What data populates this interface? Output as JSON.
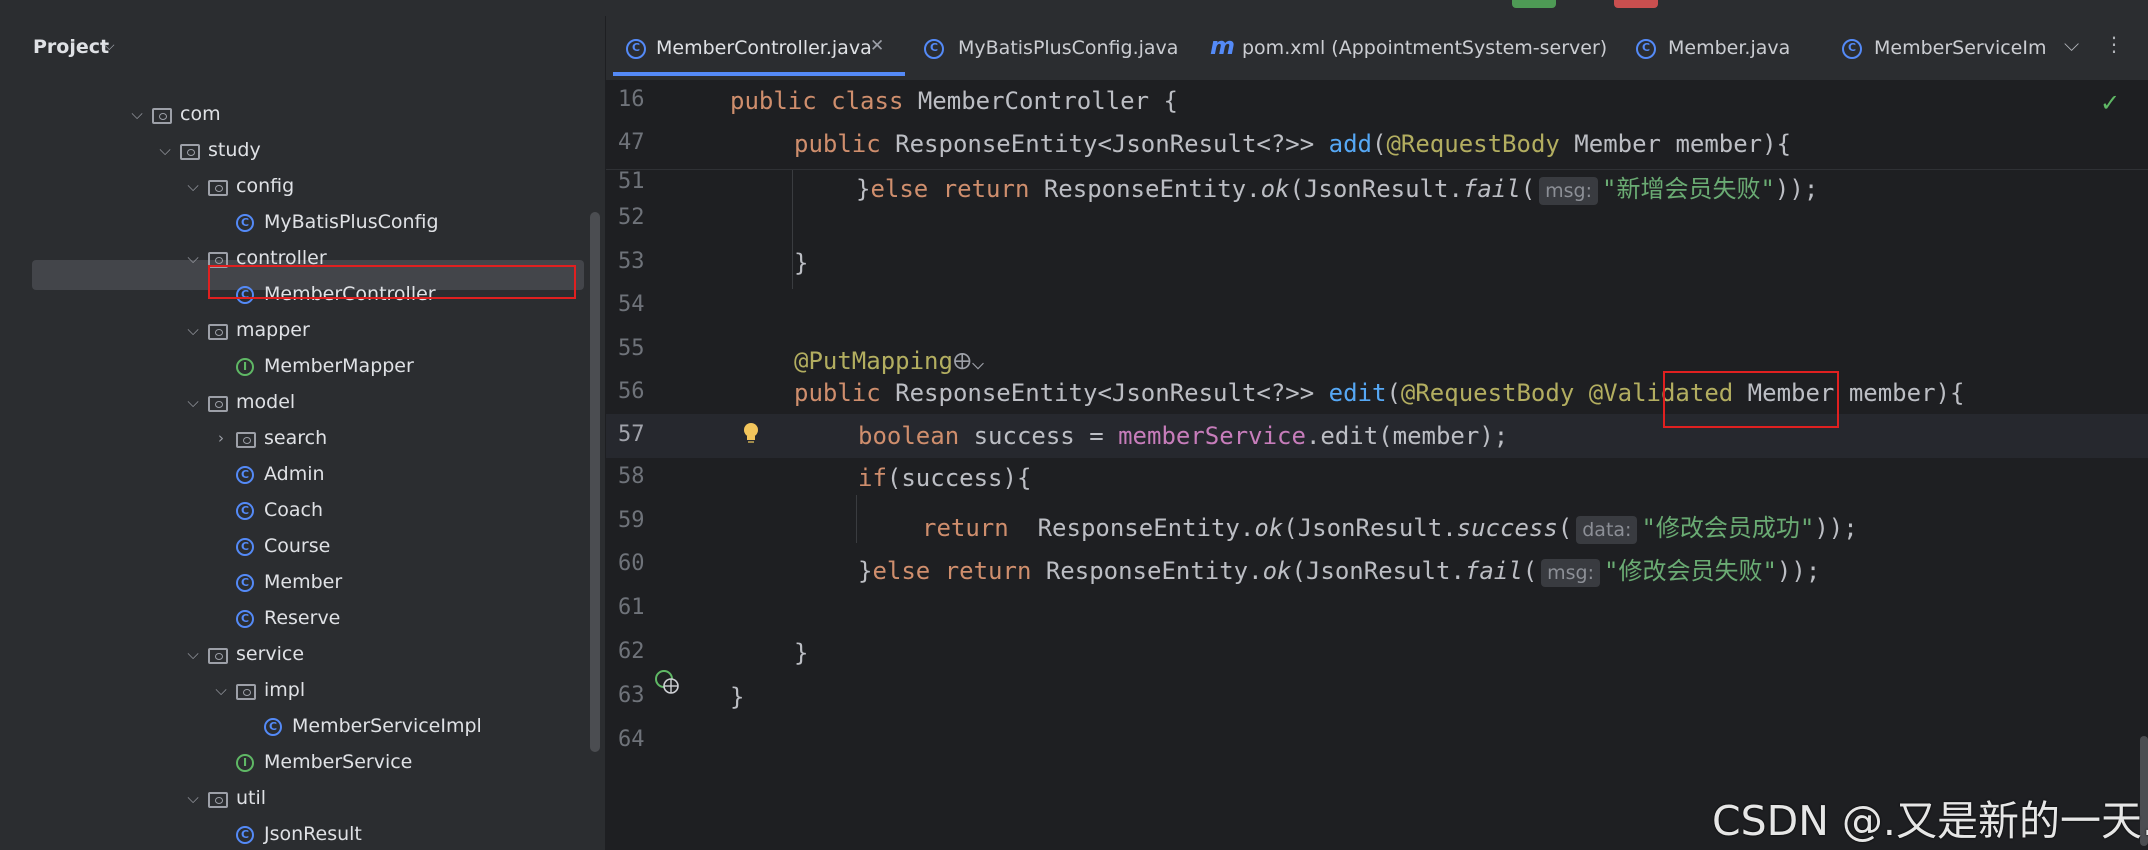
{
  "project_panel": {
    "title": "Project",
    "tree": [
      {
        "label": "com",
        "type": "folder",
        "depth": 0,
        "expanded": true
      },
      {
        "label": "study",
        "type": "folder",
        "depth": 1,
        "expanded": true
      },
      {
        "label": "config",
        "type": "folder",
        "depth": 2,
        "expanded": true
      },
      {
        "label": "MyBatisPlusConfig",
        "type": "class",
        "depth": 3
      },
      {
        "label": "controller",
        "type": "folder",
        "depth": 2,
        "expanded": true
      },
      {
        "label": "MemberController",
        "type": "class",
        "depth": 3,
        "selected": true
      },
      {
        "label": "mapper",
        "type": "folder",
        "depth": 2,
        "expanded": true
      },
      {
        "label": "MemberMapper",
        "type": "interface",
        "depth": 3
      },
      {
        "label": "model",
        "type": "folder",
        "depth": 2,
        "expanded": true
      },
      {
        "label": "search",
        "type": "folder",
        "depth": 3,
        "expanded": false
      },
      {
        "label": "Admin",
        "type": "class",
        "depth": 3
      },
      {
        "label": "Coach",
        "type": "class",
        "depth": 3
      },
      {
        "label": "Course",
        "type": "class",
        "depth": 3
      },
      {
        "label": "Member",
        "type": "class",
        "depth": 3
      },
      {
        "label": "Reserve",
        "type": "class",
        "depth": 3
      },
      {
        "label": "service",
        "type": "folder",
        "depth": 2,
        "expanded": true
      },
      {
        "label": "impl",
        "type": "folder",
        "depth": 3,
        "expanded": true
      },
      {
        "label": "MemberServiceImpl",
        "type": "class",
        "depth": 4
      },
      {
        "label": "MemberService",
        "type": "interface",
        "depth": 3
      },
      {
        "label": "util",
        "type": "folder",
        "depth": 2,
        "expanded": true
      },
      {
        "label": "JsonResult",
        "type": "class",
        "depth": 3
      }
    ]
  },
  "tabs": [
    {
      "label": "MemberController.java",
      "icon": "class-icon",
      "active": true
    },
    {
      "label": "MyBatisPlusConfig.java",
      "icon": "class-icon"
    },
    {
      "label": "pom.xml (AppointmentSystem-server)",
      "icon": "maven-icon"
    },
    {
      "label": "Member.java",
      "icon": "class-icon"
    },
    {
      "label": "MemberServiceIm",
      "icon": "class-icon"
    }
  ],
  "editor": {
    "line_numbers": [
      "16",
      "47",
      "51",
      "52",
      "53",
      "54",
      "55",
      "56",
      "57",
      "58",
      "59",
      "60",
      "61",
      "62",
      "63",
      "64"
    ],
    "hints": {
      "msg": "msg:",
      "data": "data:"
    },
    "strings": {
      "add_fail": "\"新增会员失败\"",
      "edit_success": "\"修改会员成功\"",
      "edit_fail": "\"修改会员失败\""
    },
    "annotations": {
      "put_mapping": "@PutMapping",
      "request_body": "@RequestBody",
      "validated": "@Validated"
    },
    "class_name": "MemberController"
  },
  "colors": {
    "keyword": "#cf8e6d",
    "annotation": "#b3ae60",
    "method": "#56a8f5",
    "string": "#6aab73",
    "field": "#c77dbb",
    "highlight_box": "#e02020"
  },
  "watermark": "CSDN @.又是新的一天."
}
